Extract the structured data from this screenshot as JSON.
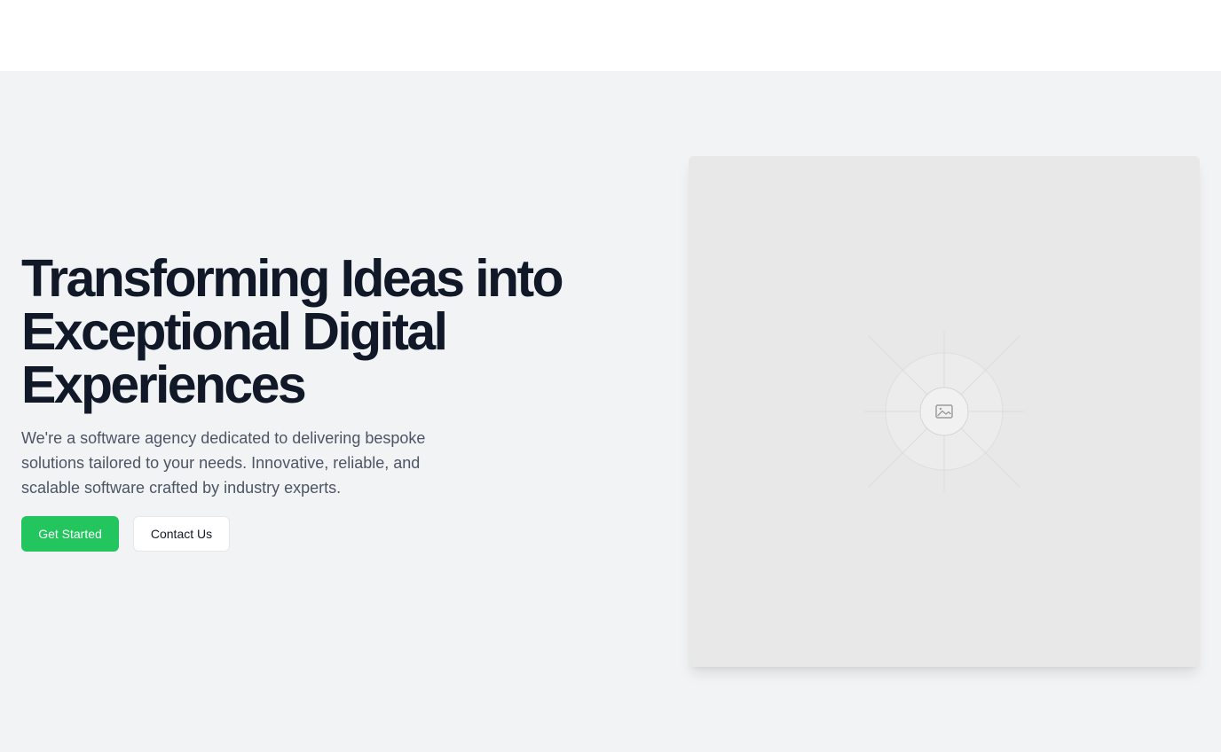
{
  "hero": {
    "headline": "Transforming Ideas into Exceptional Digital Experiences",
    "description": "We're a software agency dedicated to delivering bespoke solutions tailored to your needs. Innovative, reliable, and scalable software crafted by industry experts.",
    "primary_button_label": "Get Started",
    "secondary_button_label": "Contact Us",
    "image_icon": "image-icon"
  },
  "colors": {
    "headline": "#111827",
    "body_text": "#4b5563",
    "accent": "#22c55e",
    "hero_background": "#f2f3f5",
    "image_placeholder": "#e8e8e8"
  }
}
